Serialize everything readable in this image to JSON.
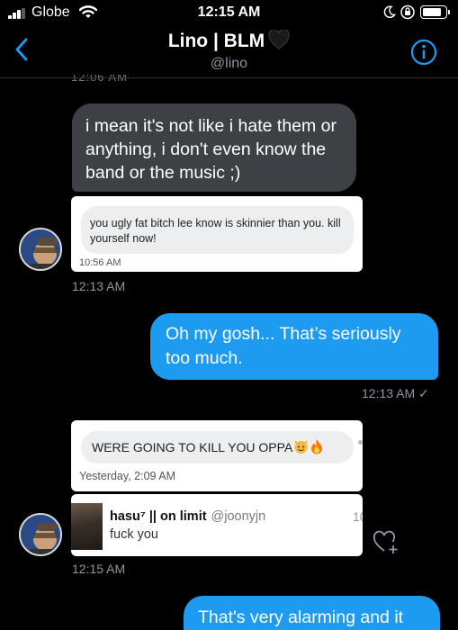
{
  "status_bar": {
    "carrier": "Globe",
    "time": "12:15 AM",
    "signal_bars": 3,
    "battery_level": 0.85
  },
  "header": {
    "title": "Lino | BLM",
    "handle": "@lino",
    "title_emoji": "black-heart-icon",
    "accent_color": "#1d9bf0"
  },
  "messages": [
    {
      "side": "received",
      "type": "text",
      "text": "i mean it's not like i hate them or anything, i don't even know the band or the music ;)"
    },
    {
      "side": "received",
      "type": "image",
      "image_text": "you ugly fat bitch lee know is skinnier than you. kill yourself now!",
      "image_time": "10:56 AM",
      "timestamp": "12:13 AM"
    },
    {
      "side": "sent",
      "type": "text",
      "text": "Oh my gosh... That’s seriously too much.",
      "timestamp": "12:13 AM ✓"
    },
    {
      "side": "received",
      "type": "image",
      "image_text": "WERE GOING TO KILL YOU OPPA",
      "image_time": "Yesterday, 2:09 AM"
    },
    {
      "side": "received",
      "type": "image",
      "reply_name": "hasu⁷ || on limit",
      "reply_handle": "@joonyjn",
      "reply_text": "fuck you",
      "reply_cut": "10",
      "timestamp": "12:15 AM"
    },
    {
      "side": "sent",
      "type": "text",
      "text": "That's very alarming and it"
    }
  ],
  "colors": {
    "background": "#000000",
    "received_bubble": "#3d4145",
    "sent_bubble": "#1d9bf0",
    "timestamp": "#8b98a5"
  }
}
